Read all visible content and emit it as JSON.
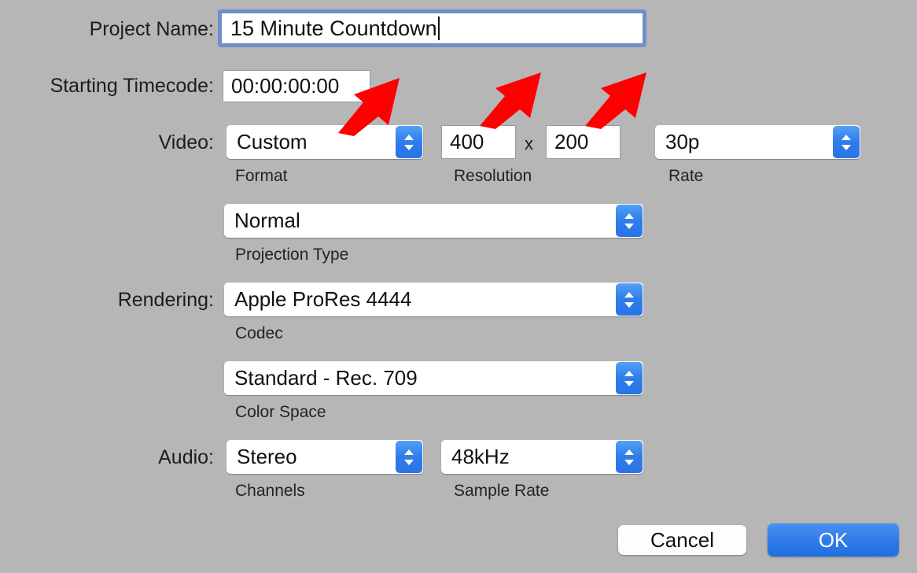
{
  "dialog": {
    "background_color": "#b6b6b6",
    "accent_color": "#2f7ceb",
    "annotation_color": "#ff0000"
  },
  "fields": {
    "project_name": {
      "label": "Project Name:",
      "value": "15 Minute Countdown",
      "focused": true
    },
    "starting_timecode": {
      "label": "Starting Timecode:",
      "value": "00:00:00:00"
    },
    "video": {
      "label": "Video:",
      "format": {
        "value": "Custom",
        "sub_label": "Format"
      },
      "resolution": {
        "width": "400",
        "height": "200",
        "separator": "x",
        "sub_label": "Resolution"
      },
      "rate": {
        "value": "30p",
        "sub_label": "Rate"
      }
    },
    "projection": {
      "value": "Normal",
      "sub_label": "Projection Type"
    },
    "rendering": {
      "label": "Rendering:",
      "codec": {
        "value": "Apple ProRes 4444",
        "sub_label": "Codec"
      },
      "color_space": {
        "value": "Standard - Rec. 709",
        "sub_label": "Color Space"
      }
    },
    "audio": {
      "label": "Audio:",
      "channels": {
        "value": "Stereo",
        "sub_label": "Channels"
      },
      "sample_rate": {
        "value": "48kHz",
        "sub_label": "Sample Rate"
      }
    }
  },
  "buttons": {
    "cancel": "Cancel",
    "ok": "OK"
  },
  "annotations": {
    "arrow_format": "red-arrow-icon",
    "arrow_res_width": "red-arrow-icon",
    "arrow_res_height": "red-arrow-icon"
  }
}
